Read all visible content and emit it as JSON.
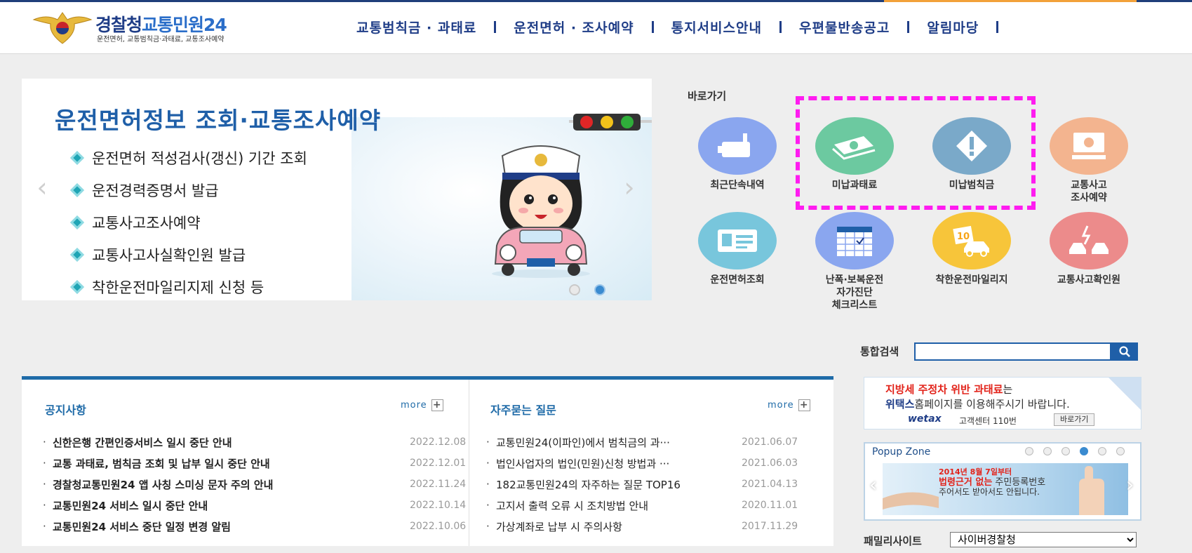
{
  "header": {
    "logo_title_pre": "경찰청",
    "logo_title_post": "교통민원24",
    "logo_subtitle": "운전면허, 교통범칙금·과태료, 교통조사예약",
    "nav": [
      {
        "label": "교통범칙금 · 과태료"
      },
      {
        "label": "운전면허 · 조사예약"
      },
      {
        "label": "통지서비스안내"
      },
      {
        "label": "우편물반송공고"
      },
      {
        "label": "알림마당"
      }
    ]
  },
  "banner": {
    "title": "운전면허정보 조회·교통조사예약",
    "items": [
      "운전면허 적성검사(갱신) 기간 조회",
      "운전경력증명서 발급",
      "교통사고조사예약",
      "교통사고사실확인원 발급",
      "착한운전마일리지제 신청 등"
    ],
    "prev_icon": "chevron-left-icon",
    "next_icon": "chevron-right-icon",
    "slide_count": 2,
    "active_slide": 2
  },
  "quick": {
    "title": "바로가기",
    "items": [
      {
        "label": "최근단속내역",
        "icon": "camera-icon",
        "color": "#8aa6ef"
      },
      {
        "label": "미납과태료",
        "icon": "money-icon",
        "color": "#6cc9a0"
      },
      {
        "label": "미납범칙금",
        "icon": "warning-icon",
        "color": "#7aa9c9"
      },
      {
        "label": "교통사고\n조사예약",
        "icon": "monitor-icon",
        "color": "#f3b48f"
      },
      {
        "label": "운전면허조회",
        "icon": "id-card-icon",
        "color": "#78c6dc"
      },
      {
        "label": "난폭·보복운전\n자가진단\n체크리스트",
        "icon": "calendar-check-icon",
        "color": "#8aa6ef"
      },
      {
        "label": "착한운전마일리지",
        "icon": "car-10-icon",
        "color": "#f7c53a"
      },
      {
        "label": "교통사고확인원",
        "icon": "car-crash-icon",
        "color": "#ec8b8b"
      }
    ],
    "highlight_color": "#ff1cf0"
  },
  "search": {
    "label": "통합검색",
    "value": "",
    "placeholder": ""
  },
  "notices": {
    "title": "공지사항",
    "more": "more",
    "items": [
      {
        "title": "신한은행 간편인증서비스 일시 중단 안내",
        "date": "2022.12.08"
      },
      {
        "title": "교통 과태료, 범칙금 조회 및 납부 일시 중단 안내",
        "date": "2022.12.01"
      },
      {
        "title": "경찰청교통민원24 앱 사칭 스미싱 문자 주의 안내",
        "date": "2022.11.24"
      },
      {
        "title": "교통민원24 서비스 일시 중단 안내",
        "date": "2022.10.14"
      },
      {
        "title": "교통민원24 서비스 중단 일정 변경 알림",
        "date": "2022.10.06"
      }
    ]
  },
  "faq": {
    "title": "자주묻는 질문",
    "more": "more",
    "items": [
      {
        "title": "교통민원24(이파인)에서 범칙금의 과···",
        "date": "2021.06.07"
      },
      {
        "title": "법인사업자의 법인(민원)신청 방법과 ···",
        "date": "2021.06.03"
      },
      {
        "title": "182교통민원24의 자주하는 질문 TOP16",
        "date": "2021.04.13"
      },
      {
        "title": "고지서 출력 오류 시 조치방법 안내",
        "date": "2020.11.01"
      },
      {
        "title": "가상계좌로 납부 시 주의사항",
        "date": "2017.11.29"
      }
    ]
  },
  "wetax": {
    "line1_red": "지방세 주정차 위반 과태료",
    "line1_rest": "는",
    "line2_blue": "위택스",
    "line2_rest": "홈페이지를 이용해주시기 바랍니다.",
    "logo": "wetax",
    "center": "고객센터 110번",
    "button": "바로가기"
  },
  "popup": {
    "title": "Popup Zone",
    "dot_count": 6,
    "active_dot": 4,
    "text1": "2014년 8월 7일부터",
    "text2_red": "법령근거 없는",
    "text2_rest": " 주민등록번호",
    "text3": "주어서도 받아서도 안됩니다."
  },
  "family": {
    "label": "패밀리사이트",
    "selected": "사이버경찰청"
  }
}
